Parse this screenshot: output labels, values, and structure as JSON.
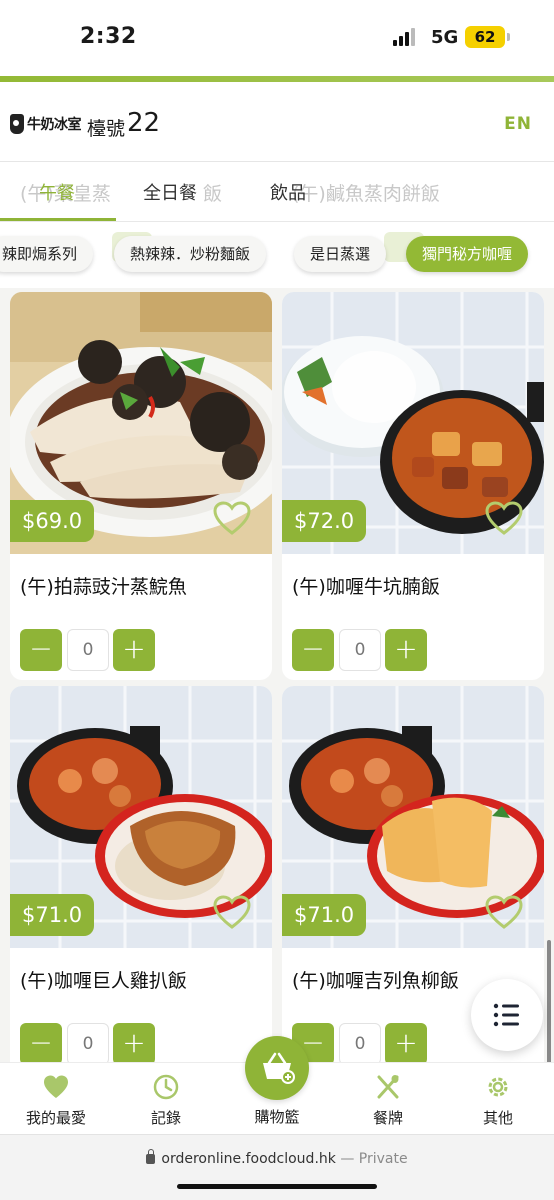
{
  "status_bar": {
    "time": "2:32",
    "network": "5G",
    "battery": "62"
  },
  "header": {
    "logo_text": "牛奶冰室",
    "table_label": "檯號",
    "table_number": "22",
    "language_button": "EN"
  },
  "category_tabs": {
    "ghost_text_1": "(午)菜皇蒸",
    "ghost_text_2": "飯",
    "ghost_text_3": "(午)鹹魚蒸肉餅飯",
    "items": [
      {
        "label": "午餐",
        "active": true
      },
      {
        "label": "全日餐",
        "active": false
      },
      {
        "label": "飲品",
        "active": false
      }
    ]
  },
  "subcategory_chips": [
    {
      "label": "辣即焗系列",
      "active": false
    },
    {
      "label": "熱辣辣．炒粉麵飯",
      "active": false
    },
    {
      "label": "是日蒸選",
      "active": false
    },
    {
      "label": "獨門秘方咖喱",
      "active": true
    }
  ],
  "products": [
    {
      "name": "(午)拍蒜豉汁蒸鯇魚",
      "price": "$69.0",
      "quantity": "0",
      "favorited": false,
      "image": "steamed-fish-black-bean"
    },
    {
      "name": "(午)咖喱牛坑腩飯",
      "price": "$72.0",
      "quantity": "0",
      "favorited": false,
      "image": "curry-beef-brisket-rice"
    },
    {
      "name": "(午)咖喱巨人雞扒飯",
      "price": "$71.0",
      "quantity": "0",
      "favorited": false,
      "image": "curry-chicken-chop-rice"
    },
    {
      "name": "(午)咖喱吉列魚柳飯",
      "price": "$71.0",
      "quantity": "0",
      "favorited": false,
      "image": "curry-fried-fish-fillet-rice"
    }
  ],
  "controls": {
    "minus_symbol": "−",
    "plus_symbol": "+"
  },
  "bottom_nav": {
    "favorites": "我的最愛",
    "records": "記錄",
    "cart": "購物籃",
    "menu": "餐牌",
    "others": "其他"
  },
  "browser": {
    "url": "orderonline.foodcloud.hk",
    "mode": "— Private"
  },
  "colors": {
    "accent": "#8fb437",
    "battery": "#f5d000"
  }
}
